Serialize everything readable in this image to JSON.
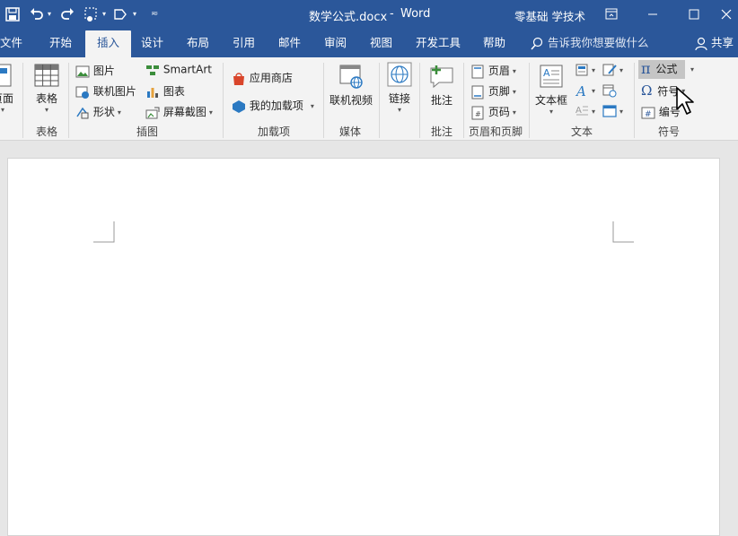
{
  "window": {
    "doc_title": "数学公式.docx",
    "separator": "-",
    "app_name": "Word",
    "account": "零基础 学技术"
  },
  "menu": {
    "tabs": [
      "文件",
      "开始",
      "插入",
      "设计",
      "布局",
      "引用",
      "邮件",
      "审阅",
      "视图",
      "开发工具",
      "帮助"
    ],
    "active_tab": "插入",
    "search_placeholder": "告诉我你想要做什么",
    "share": "共享"
  },
  "ribbon": {
    "pages": {
      "label": "页面",
      "group": ""
    },
    "tables": {
      "label": "表格",
      "group": "表格"
    },
    "illustrations": {
      "group": "插图",
      "items": [
        "图片",
        "联机图片",
        "形状",
        "SmartArt",
        "图表",
        "屏幕截图"
      ]
    },
    "addins": {
      "group": "加载项",
      "items": [
        "应用商店",
        "我的加载项"
      ]
    },
    "media": {
      "label": "联机视频",
      "group": "媒体"
    },
    "links": {
      "label": "链接",
      "group": ""
    },
    "comments": {
      "label": "批注",
      "group": "批注"
    },
    "header_footer": {
      "group": "页眉和页脚",
      "items": [
        "页眉",
        "页脚",
        "页码"
      ]
    },
    "text": {
      "label": "文本框",
      "group": "文本"
    },
    "symbols": {
      "group": "符号",
      "items": [
        "公式",
        "符号",
        "编号"
      ],
      "equation_glyph": "π",
      "symbol_glyph": "Ω"
    }
  },
  "colors": {
    "brand": "#2b579a",
    "ribbon_bg": "#f3f3f3",
    "highlight": "#c5c5c5"
  }
}
